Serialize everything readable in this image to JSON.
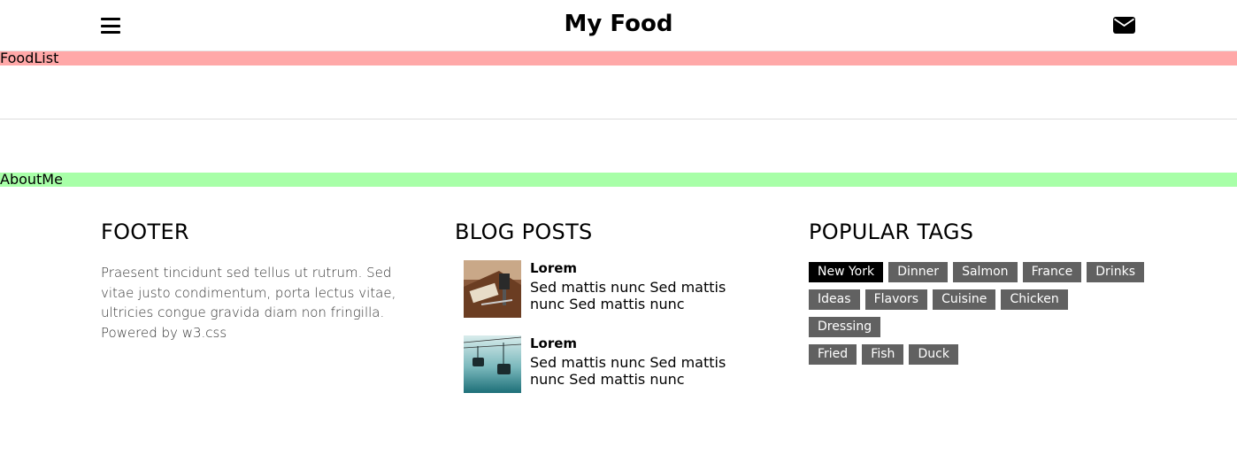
{
  "header": {
    "title": "My Food",
    "menu_icon": "hamburger-icon",
    "mail_icon": "envelope-icon"
  },
  "sections": {
    "food_list_label": "FoodList",
    "about_label": "AboutMe"
  },
  "footer": {
    "heading": "FOOTER",
    "text": "Praesent tincidunt sed tellus ut rutrum. Sed vitae justo condimentum, porta lectus vitae, ultricies congue gravida diam non fringilla. Powered by w3.css"
  },
  "blog": {
    "heading": "BLOG POSTS",
    "posts": [
      {
        "title": "Lorem",
        "body": "Sed mattis nunc Sed mattis nunc Sed mattis nunc"
      },
      {
        "title": "Lorem",
        "body": "Sed mattis nunc Sed mattis nunc Sed mattis nunc"
      }
    ]
  },
  "tags": {
    "heading": "POPULAR TAGS",
    "items": [
      "New York",
      "Dinner",
      "Salmon",
      "France",
      "Drinks",
      "Ideas",
      "Flavors",
      "Cuisine",
      "Chicken",
      "Dressing",
      "Fried",
      "Fish",
      "Duck"
    ],
    "active": "New York"
  },
  "colors": {
    "tag_bg": "#616161",
    "tag_active_bg": "#000000",
    "foodlist_band": "#ffa8a8",
    "about_band": "#a8ffa8"
  }
}
